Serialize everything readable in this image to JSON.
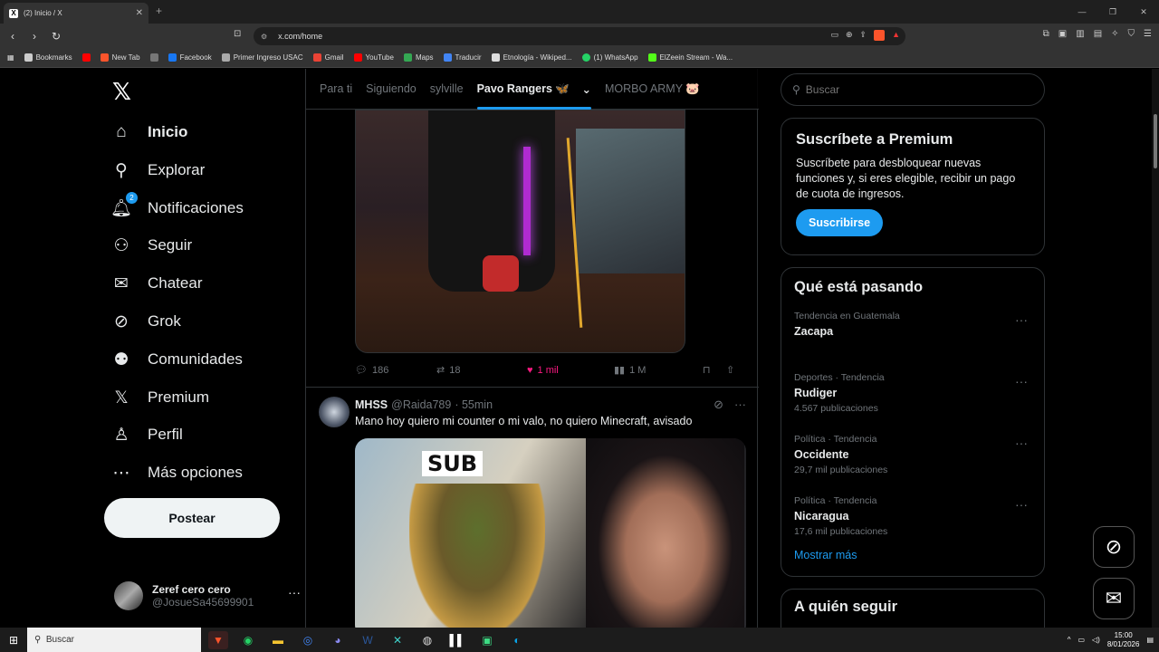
{
  "browser": {
    "tab_title": "(2) Inicio / X",
    "tab_favicon": "X",
    "new_tab": "+",
    "url": "x.com/home",
    "bookmarks": [
      {
        "label": "Bookmarks",
        "color": "#cccccc"
      },
      {
        "label": "",
        "color": "#ff0000"
      },
      {
        "label": "New Tab",
        "color": "#fb542b"
      },
      {
        "label": "",
        "color": "#777777"
      },
      {
        "label": "Facebook",
        "color": "#1877f2"
      },
      {
        "label": "Primer Ingreso USAC",
        "color": "#aaaaaa"
      },
      {
        "label": "Gmail",
        "color": "#ea4335"
      },
      {
        "label": "YouTube",
        "color": "#ff0000"
      },
      {
        "label": "Maps",
        "color": "#34a853"
      },
      {
        "label": "Traducir",
        "color": "#4285f4"
      },
      {
        "label": "Etnología - Wikiped...",
        "color": "#dddddd"
      },
      {
        "label": "(1) WhatsApp",
        "color": "#25d366"
      },
      {
        "label": "ElZeein Stream - Wa...",
        "color": "#53fc18"
      }
    ]
  },
  "nav": {
    "items": [
      {
        "label": "Inicio",
        "icon": "home-icon",
        "glyph": "⌂"
      },
      {
        "label": "Explorar",
        "icon": "search-icon",
        "glyph": "⚲"
      },
      {
        "label": "Notificaciones",
        "icon": "bell-icon",
        "glyph": "🔔︎",
        "badge": "2"
      },
      {
        "label": "Seguir",
        "icon": "add-user-icon",
        "glyph": "⚇"
      },
      {
        "label": "Chatear",
        "icon": "mail-icon",
        "glyph": "✉"
      },
      {
        "label": "Grok",
        "icon": "grok-icon",
        "glyph": "⊘"
      },
      {
        "label": "Comunidades",
        "icon": "communities-icon",
        "glyph": "⚉"
      },
      {
        "label": "Premium",
        "icon": "x-icon",
        "glyph": "𝕏"
      },
      {
        "label": "Perfil",
        "icon": "profile-icon",
        "glyph": "♙"
      },
      {
        "label": "Más opciones",
        "icon": "more-icon",
        "glyph": "⋯"
      }
    ],
    "post_button": "Postear",
    "account_name": "Zeref cero cero",
    "account_handle": "@JosueSa45699901"
  },
  "feed": {
    "tabs": [
      "Para ti",
      "Siguiendo",
      "sylville",
      "Pavo Rangers 🦋",
      "MORBO ARMY 🐷"
    ],
    "post1_actions": {
      "replies": "186",
      "reposts": "18",
      "likes": "1 mil",
      "views": "1 M"
    },
    "post2": {
      "name": "MHSS",
      "handle": "@Raida789",
      "time": "· 55min",
      "text": "Mano hoy quiero mi counter o mi valo, no quiero Minecraft, avisado",
      "image_text": "SUB"
    }
  },
  "sidebar": {
    "search_placeholder": "Buscar",
    "premium_title": "Suscríbete a Premium",
    "premium_text": "Suscríbete para desbloquear nuevas funciones y, si eres elegible, recibir un pago de cuota de ingresos.",
    "premium_button": "Suscribirse",
    "trends_title": "Qué está pasando",
    "trends": [
      {
        "context": "Tendencia en Guatemala",
        "name": "Zacapa",
        "count": ""
      },
      {
        "context": "Deportes · Tendencia",
        "name": "Rudiger",
        "count": "4.567 publicaciones"
      },
      {
        "context": "Política · Tendencia",
        "name": "Occidente",
        "count": "29,7 mil publicaciones"
      },
      {
        "context": "Política · Tendencia",
        "name": "Nicaragua",
        "count": "17,6 mil publicaciones"
      }
    ],
    "show_more": "Mostrar más",
    "follow_title": "A quién seguir"
  },
  "taskbar": {
    "search": "Buscar",
    "time": "15:00",
    "date": "8/01/2026"
  },
  "colors": {
    "accent": "#1d9bf0",
    "like": "#f91880",
    "background": "#000000"
  }
}
